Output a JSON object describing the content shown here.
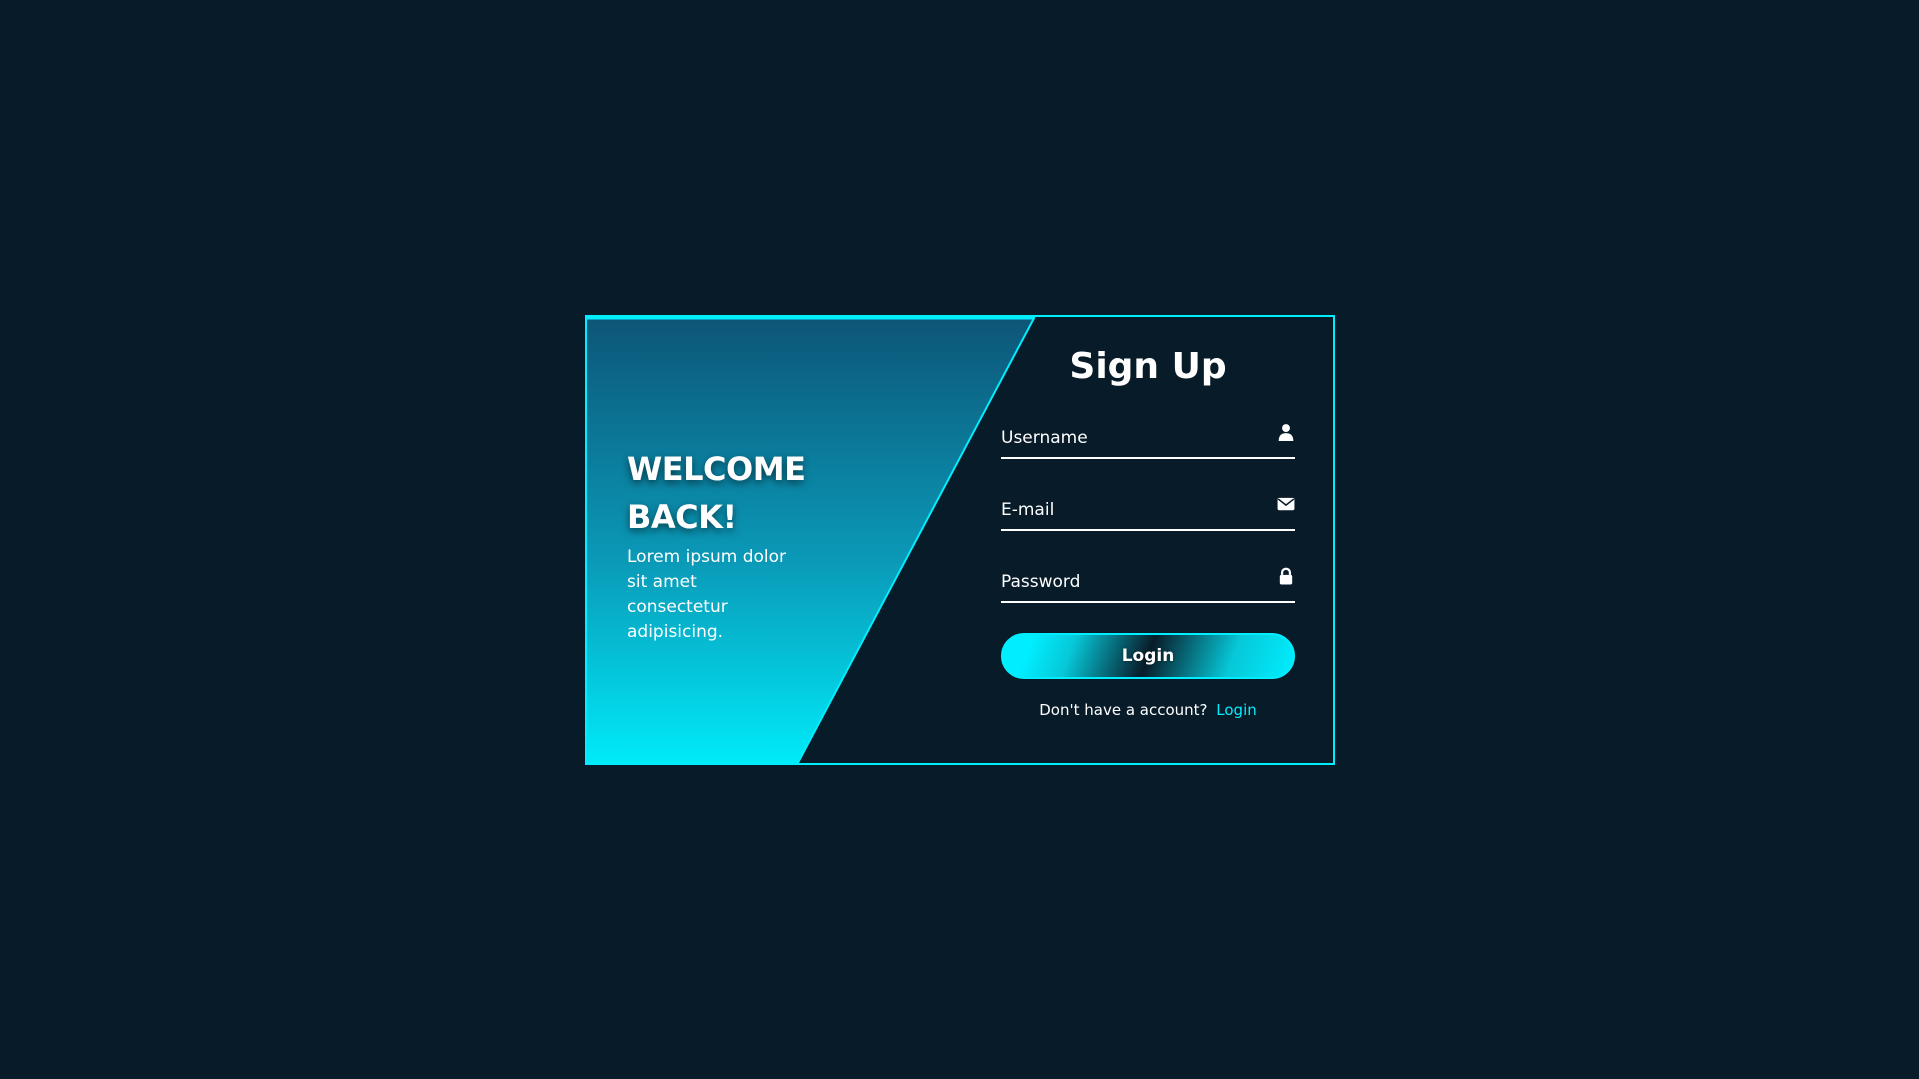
{
  "panel": {
    "heading": "WELCOME BACK!",
    "text": "Lorem ipsum dolor sit amet consectetur adipisicing."
  },
  "form": {
    "title": "Sign Up",
    "fields": [
      {
        "placeholder": "Username",
        "icon": "user-icon"
      },
      {
        "placeholder": "E-mail",
        "icon": "envelope-icon"
      },
      {
        "placeholder": "Password",
        "icon": "lock-icon"
      }
    ],
    "submit_label": "Login",
    "footer_text": "Don't have a account?",
    "footer_link": "Login"
  },
  "colors": {
    "background": "#081b29",
    "accent": "#00eeff",
    "panel_top": "#0d5577",
    "panel_bottom": "#00eeff",
    "text": "#ffffff"
  }
}
